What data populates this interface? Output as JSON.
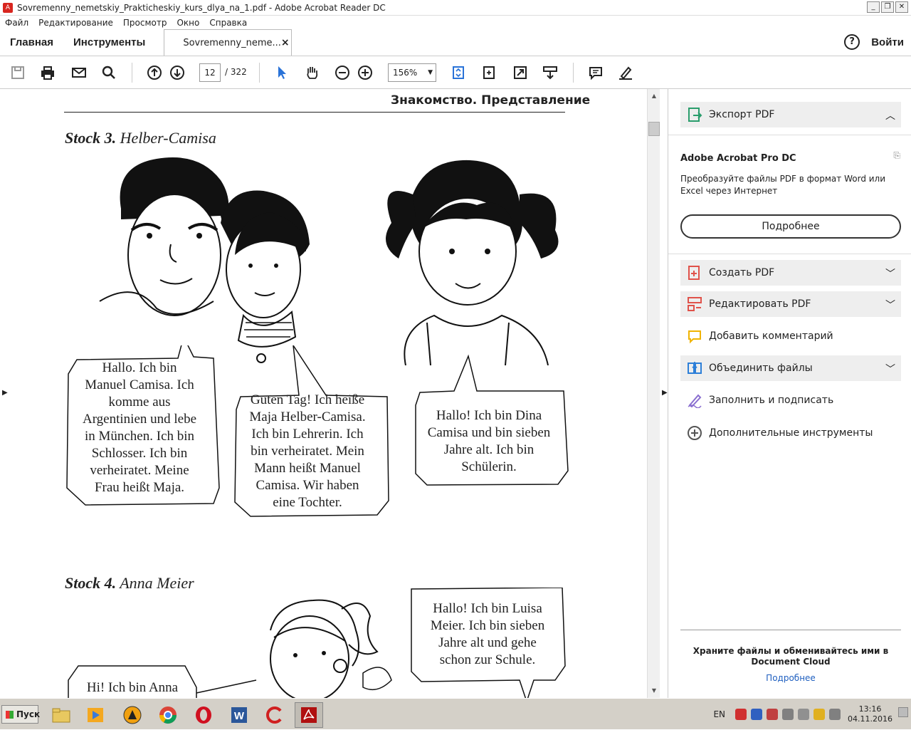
{
  "window": {
    "title": "Sovremenny_nemetskiy_Prakticheskiy_kurs_dlya_na_1.pdf - Adobe Acrobat Reader DC",
    "minimize": "_",
    "restore": "❐",
    "close": "✕"
  },
  "menu": [
    "Файл",
    "Редактирование",
    "Просмотр",
    "Окно",
    "Справка"
  ],
  "tabs": {
    "home": "Главная",
    "tools": "Инструменты",
    "document": "Sovremenny_neme...",
    "close": "×",
    "help": "?",
    "login": "Войти"
  },
  "toolbar": {
    "page_current": "12",
    "page_total": "/  322",
    "zoom": "156%",
    "icons": [
      "save-icon",
      "print-icon",
      "email-icon",
      "search-icon",
      "page-up-icon",
      "page-down-icon",
      "select-icon",
      "hand-icon",
      "zoom-out-icon",
      "zoom-in-icon",
      "fit-page-icon",
      "rotate-icon",
      "fullscreen-icon",
      "scroll-mode-icon",
      "comment-icon",
      "highlight-icon"
    ]
  },
  "page": {
    "header": "Знакомство. Представление",
    "stock3": {
      "num": "Stock 3.",
      "name": "Helber-Camisa"
    },
    "stock4": {
      "num": "Stock 4.",
      "name": "Anna Meier"
    },
    "bubbles": {
      "manuel": [
        "Hallo. Ich bin",
        "Manuel Camisa. Ich",
        "komme aus",
        "Argentinien und lebe",
        "in München. Ich bin",
        "Schlosser. Ich bin",
        "verheiratet. Meine",
        "Frau heißt Maja."
      ],
      "maja": [
        "Guten Tag! Ich heiße",
        "Maja Helber-Camisa.",
        "Ich bin Lehrerin. Ich",
        "bin verheiratet. Mein",
        "Mann heißt Manuel",
        "Camisa. Wir haben",
        "eine Tochter."
      ],
      "dina": [
        "Hallo! Ich bin Dina",
        "Camisa und bin sieben",
        "Jahre alt. Ich bin",
        "Schülerin."
      ],
      "luisa": [
        "Hallo! Ich bin Luisa",
        "Meier. Ich bin sieben",
        "Jahre alt und gehe",
        "schon zur Schule."
      ],
      "anna": [
        "Hi! Ich bin Anna"
      ]
    }
  },
  "right_pane": {
    "export_pdf": "Экспорт PDF",
    "promo_title": "Adobe Acrobat Pro DC",
    "promo_text": "Преобразуйте файлы PDF в формат Word или Excel через Интернет",
    "promo_button": "Подробнее",
    "tools": [
      {
        "label": "Создать PDF",
        "icon": "create-pdf-icon",
        "color": "#e0524a"
      },
      {
        "label": "Редактировать PDF",
        "icon": "edit-pdf-icon",
        "color": "#e0524a"
      },
      {
        "label": "Добавить комментарий",
        "icon": "comment-icon",
        "color": "#f0b400"
      },
      {
        "label": "Объединить файлы",
        "icon": "combine-icon",
        "color": "#2d7fd8"
      },
      {
        "label": "Заполнить и подписать",
        "icon": "sign-icon",
        "color": "#8a6fd0"
      },
      {
        "label": "Дополнительные инструменты",
        "icon": "more-tools-icon",
        "color": "#555555"
      }
    ],
    "cloud_text": "Храните файлы и обменивайтесь ими в Document Cloud",
    "cloud_link": "Подробнее"
  },
  "taskbar": {
    "start": "Пуск",
    "lang": "EN",
    "time": "13:16",
    "date": "04.11.2016"
  }
}
